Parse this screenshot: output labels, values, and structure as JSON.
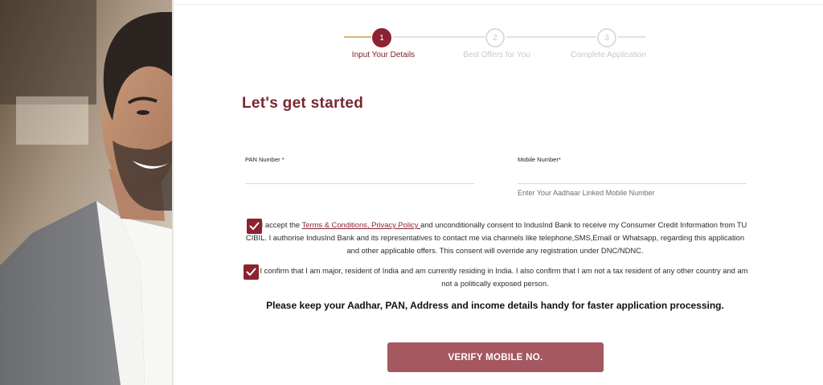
{
  "stepper": {
    "steps": [
      {
        "number": "1",
        "label": "Input  Your Details",
        "state": "active"
      },
      {
        "number": "2",
        "label": "Best Offers for You",
        "state": "inactive"
      },
      {
        "number": "3",
        "label": "Complete Application",
        "state": "inactive"
      }
    ]
  },
  "form": {
    "title": "Let's get started",
    "pan": {
      "label": "PAN Number *",
      "value": ""
    },
    "mobile": {
      "label": "Mobile Number*",
      "value": "",
      "hint": "Enter Your Aadhaar Linked Mobile Number"
    }
  },
  "consents": [
    {
      "checked": true,
      "text_before": "I accept the ",
      "link_text": "Terms & Conditions, Privacy Policy ",
      "text_after": "and unconditionally consent to IndusInd Bank to receive my Consumer Credit Information from TU CIBIL. I authorise IndusInd Bank and its representatives to contact me via channels like telephone,SMS,Email or Whatsapp, regarding this application and other applicable offers. This consent will override any registration under DNC/NDNC."
    },
    {
      "checked": true,
      "text": "I confirm that I am major, resident of India and am currently residing in India. I also confirm that I am not a tax resident of any other country and am not a politically exposed person."
    }
  ],
  "notice": "Please keep your Aadhar, PAN, Address and income details handy for faster application processing.",
  "verify_button": {
    "label": "VERIFY MOBILE NO."
  },
  "colors": {
    "brand": "#8b2332",
    "button": "#a5585f",
    "step_active_line": "#d7b57a"
  },
  "icons": {
    "checkbox": "checkmark-icon"
  }
}
